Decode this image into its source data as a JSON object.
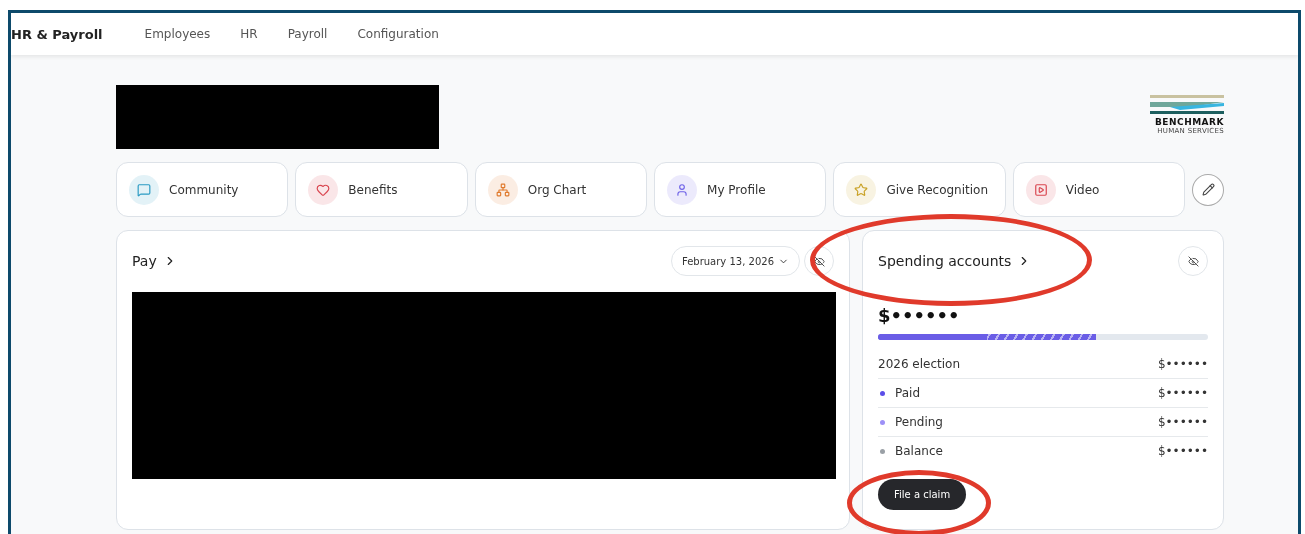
{
  "app_title": "HR & Payroll",
  "nav": [
    {
      "label": "Employees",
      "selected": false
    },
    {
      "label": "HR",
      "selected": false
    },
    {
      "label": "Payroll",
      "selected": false
    },
    {
      "label": "Configuration",
      "selected": false
    }
  ],
  "logo": {
    "name": "BENCHMARK",
    "tagline": "HUMAN SERVICES"
  },
  "shortcuts": [
    {
      "label": "Community",
      "kind": "chat"
    },
    {
      "label": "Benefits",
      "kind": "heart"
    },
    {
      "label": "Org Chart",
      "kind": "org"
    },
    {
      "label": "My Profile",
      "kind": "person"
    },
    {
      "label": "Give Recognition",
      "kind": "star"
    },
    {
      "label": "Video",
      "kind": "video"
    }
  ],
  "pay": {
    "title": "Pay",
    "date": "February 13, 2026"
  },
  "spending": {
    "title": "Spending accounts",
    "amount": "$••••••",
    "bar": [
      {
        "kind": "solid",
        "level": 0.33
      },
      {
        "kind": "striped",
        "level": 0.66
      }
    ],
    "rows": [
      {
        "label": "2026 election",
        "value": "$••••••"
      },
      {
        "label": "Paid",
        "value": "$••••••",
        "color": "#5b4ee8"
      },
      {
        "label": "Pending",
        "value": "$••••••",
        "color": "#9d90f7"
      },
      {
        "label": "Balance",
        "value": "$••••••",
        "color": "#9aa0a6"
      }
    ],
    "button": "File a claim"
  }
}
